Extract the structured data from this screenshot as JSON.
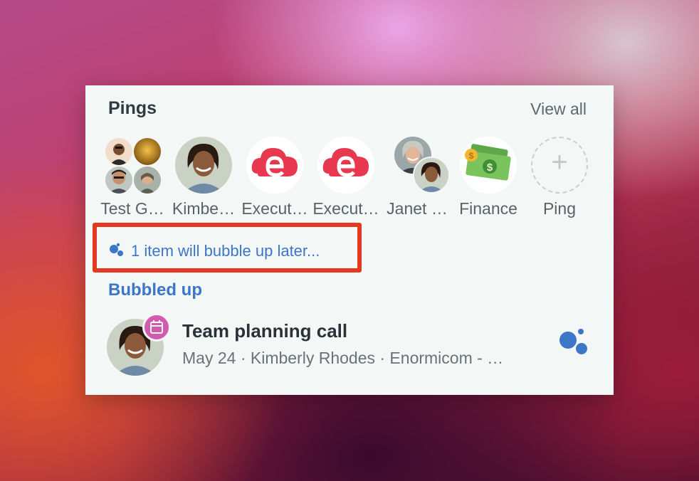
{
  "header": {
    "title": "Pings",
    "view_all": "View all"
  },
  "pings": [
    {
      "name": "Test G…",
      "icon": "group-avatar-icon"
    },
    {
      "name": "Kimbe…",
      "icon": "avatar"
    },
    {
      "name": "Execut…",
      "icon": "enormicom-logo-icon"
    },
    {
      "name": "Execut…",
      "icon": "enormicom-logo-icon"
    },
    {
      "name": "Janet …",
      "icon": "pair-avatar-icon"
    },
    {
      "name": "Finance",
      "icon": "money-icon"
    },
    {
      "name": "Ping",
      "icon": "plus-icon"
    }
  ],
  "bubble_later": {
    "text": "1 item will bubble up later..."
  },
  "section": {
    "title": "Bubbled up"
  },
  "item": {
    "title": "Team planning call",
    "meta": "May 24 · Kimberly Rhodes · Enormicom - …"
  },
  "colors": {
    "accent": "#3b76c9",
    "highlight": "#e53a20",
    "calendar_badge": "#d25bb0",
    "logo_red": "#e8384f"
  }
}
